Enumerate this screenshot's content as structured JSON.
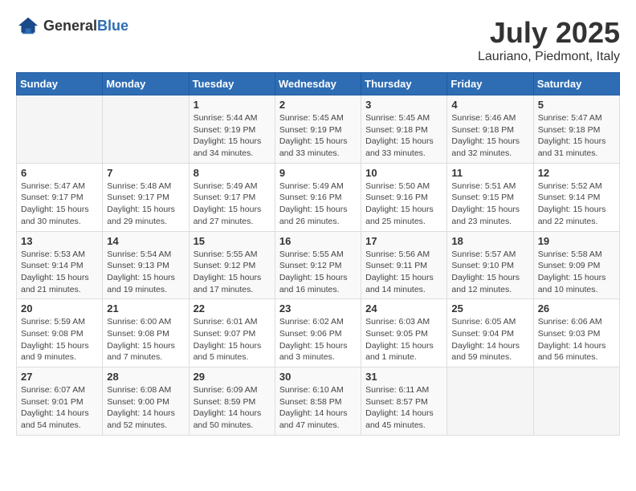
{
  "header": {
    "logo_general": "General",
    "logo_blue": "Blue",
    "month_year": "July 2025",
    "location": "Lauriano, Piedmont, Italy"
  },
  "weekdays": [
    "Sunday",
    "Monday",
    "Tuesday",
    "Wednesday",
    "Thursday",
    "Friday",
    "Saturday"
  ],
  "weeks": [
    [
      {
        "day": "",
        "info": ""
      },
      {
        "day": "",
        "info": ""
      },
      {
        "day": "1",
        "info": "Sunrise: 5:44 AM\nSunset: 9:19 PM\nDaylight: 15 hours\nand 34 minutes."
      },
      {
        "day": "2",
        "info": "Sunrise: 5:45 AM\nSunset: 9:19 PM\nDaylight: 15 hours\nand 33 minutes."
      },
      {
        "day": "3",
        "info": "Sunrise: 5:45 AM\nSunset: 9:18 PM\nDaylight: 15 hours\nand 33 minutes."
      },
      {
        "day": "4",
        "info": "Sunrise: 5:46 AM\nSunset: 9:18 PM\nDaylight: 15 hours\nand 32 minutes."
      },
      {
        "day": "5",
        "info": "Sunrise: 5:47 AM\nSunset: 9:18 PM\nDaylight: 15 hours\nand 31 minutes."
      }
    ],
    [
      {
        "day": "6",
        "info": "Sunrise: 5:47 AM\nSunset: 9:17 PM\nDaylight: 15 hours\nand 30 minutes."
      },
      {
        "day": "7",
        "info": "Sunrise: 5:48 AM\nSunset: 9:17 PM\nDaylight: 15 hours\nand 29 minutes."
      },
      {
        "day": "8",
        "info": "Sunrise: 5:49 AM\nSunset: 9:17 PM\nDaylight: 15 hours\nand 27 minutes."
      },
      {
        "day": "9",
        "info": "Sunrise: 5:49 AM\nSunset: 9:16 PM\nDaylight: 15 hours\nand 26 minutes."
      },
      {
        "day": "10",
        "info": "Sunrise: 5:50 AM\nSunset: 9:16 PM\nDaylight: 15 hours\nand 25 minutes."
      },
      {
        "day": "11",
        "info": "Sunrise: 5:51 AM\nSunset: 9:15 PM\nDaylight: 15 hours\nand 23 minutes."
      },
      {
        "day": "12",
        "info": "Sunrise: 5:52 AM\nSunset: 9:14 PM\nDaylight: 15 hours\nand 22 minutes."
      }
    ],
    [
      {
        "day": "13",
        "info": "Sunrise: 5:53 AM\nSunset: 9:14 PM\nDaylight: 15 hours\nand 21 minutes."
      },
      {
        "day": "14",
        "info": "Sunrise: 5:54 AM\nSunset: 9:13 PM\nDaylight: 15 hours\nand 19 minutes."
      },
      {
        "day": "15",
        "info": "Sunrise: 5:55 AM\nSunset: 9:12 PM\nDaylight: 15 hours\nand 17 minutes."
      },
      {
        "day": "16",
        "info": "Sunrise: 5:55 AM\nSunset: 9:12 PM\nDaylight: 15 hours\nand 16 minutes."
      },
      {
        "day": "17",
        "info": "Sunrise: 5:56 AM\nSunset: 9:11 PM\nDaylight: 15 hours\nand 14 minutes."
      },
      {
        "day": "18",
        "info": "Sunrise: 5:57 AM\nSunset: 9:10 PM\nDaylight: 15 hours\nand 12 minutes."
      },
      {
        "day": "19",
        "info": "Sunrise: 5:58 AM\nSunset: 9:09 PM\nDaylight: 15 hours\nand 10 minutes."
      }
    ],
    [
      {
        "day": "20",
        "info": "Sunrise: 5:59 AM\nSunset: 9:08 PM\nDaylight: 15 hours\nand 9 minutes."
      },
      {
        "day": "21",
        "info": "Sunrise: 6:00 AM\nSunset: 9:08 PM\nDaylight: 15 hours\nand 7 minutes."
      },
      {
        "day": "22",
        "info": "Sunrise: 6:01 AM\nSunset: 9:07 PM\nDaylight: 15 hours\nand 5 minutes."
      },
      {
        "day": "23",
        "info": "Sunrise: 6:02 AM\nSunset: 9:06 PM\nDaylight: 15 hours\nand 3 minutes."
      },
      {
        "day": "24",
        "info": "Sunrise: 6:03 AM\nSunset: 9:05 PM\nDaylight: 15 hours\nand 1 minute."
      },
      {
        "day": "25",
        "info": "Sunrise: 6:05 AM\nSunset: 9:04 PM\nDaylight: 14 hours\nand 59 minutes."
      },
      {
        "day": "26",
        "info": "Sunrise: 6:06 AM\nSunset: 9:03 PM\nDaylight: 14 hours\nand 56 minutes."
      }
    ],
    [
      {
        "day": "27",
        "info": "Sunrise: 6:07 AM\nSunset: 9:01 PM\nDaylight: 14 hours\nand 54 minutes."
      },
      {
        "day": "28",
        "info": "Sunrise: 6:08 AM\nSunset: 9:00 PM\nDaylight: 14 hours\nand 52 minutes."
      },
      {
        "day": "29",
        "info": "Sunrise: 6:09 AM\nSunset: 8:59 PM\nDaylight: 14 hours\nand 50 minutes."
      },
      {
        "day": "30",
        "info": "Sunrise: 6:10 AM\nSunset: 8:58 PM\nDaylight: 14 hours\nand 47 minutes."
      },
      {
        "day": "31",
        "info": "Sunrise: 6:11 AM\nSunset: 8:57 PM\nDaylight: 14 hours\nand 45 minutes."
      },
      {
        "day": "",
        "info": ""
      },
      {
        "day": "",
        "info": ""
      }
    ]
  ]
}
